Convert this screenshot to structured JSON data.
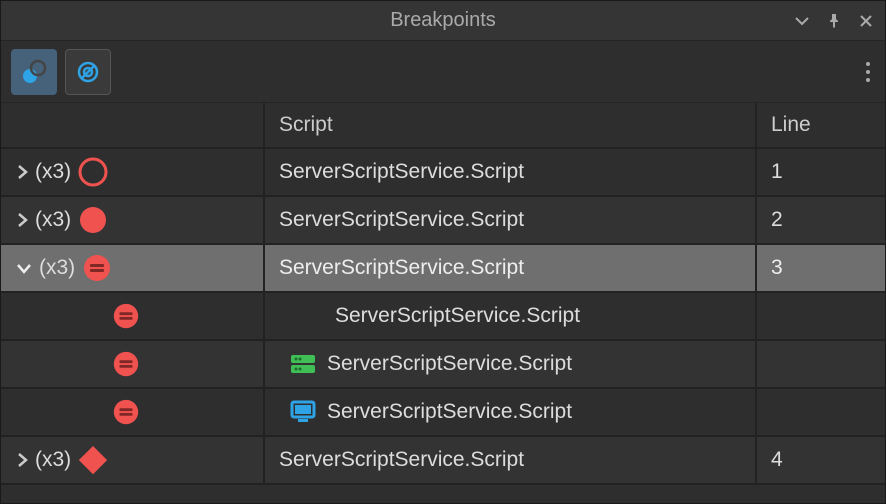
{
  "title": "Breakpoints",
  "columns": {
    "c1": "",
    "c2": "Script",
    "c3": "Line"
  },
  "rows": [
    {
      "count": "(x3)",
      "script": "ServerScriptService.Script",
      "line": "1"
    },
    {
      "count": "(x3)",
      "script": "ServerScriptService.Script",
      "line": "2"
    },
    {
      "count": "(x3)",
      "script": "ServerScriptService.Script",
      "line": "3"
    },
    {
      "script": "ServerScriptService.Script"
    },
    {
      "script": "ServerScriptService.Script"
    },
    {
      "script": "ServerScriptService.Script"
    },
    {
      "count": "(x3)",
      "script": "ServerScriptService.Script",
      "line": "4"
    }
  ],
  "colors": {
    "bpRed": "#f0524f",
    "accentBlue": "#2ea3e6",
    "serverGreen": "#3fbf56"
  }
}
